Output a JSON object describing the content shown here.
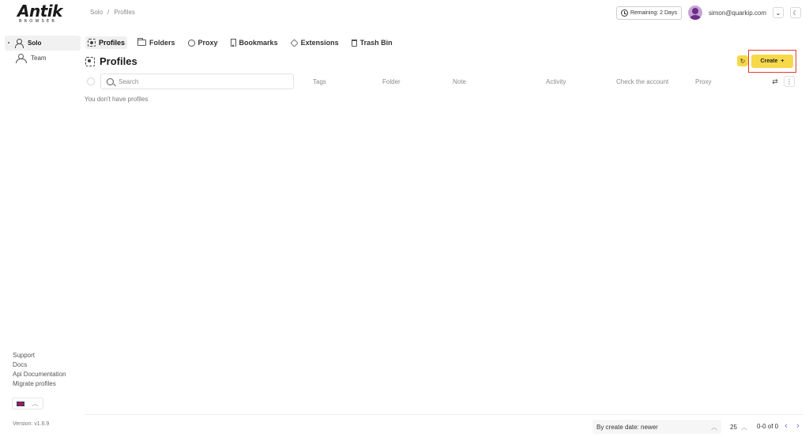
{
  "logo": {
    "main": "Antik",
    "sub": "BROWSER"
  },
  "breadcrumb": [
    "Solo",
    "/",
    "Profiles"
  ],
  "header": {
    "remaining": "Remaining: 2 Days",
    "email": "simon@quarkip.com"
  },
  "sidebar": {
    "items": [
      {
        "label": "Solo",
        "active": true
      },
      {
        "label": "Team",
        "active": false
      }
    ],
    "links": [
      "Support",
      "Docs",
      "Api Documentation",
      "Migrate profiles"
    ],
    "version": "Version: v1.6.9"
  },
  "tabs": [
    "Profiles",
    "Folders",
    "Proxy",
    "Bookmarks",
    "Extensions",
    "Trash Bin"
  ],
  "main": {
    "title": "Profiles",
    "create_label": "Create",
    "search_placeholder": "Search",
    "columns": [
      "Tags",
      "Folder",
      "Note",
      "Activity",
      "Check the account",
      "Proxy"
    ],
    "empty_message": "You don't have profiles"
  },
  "footer": {
    "sort_label": "By create date: newer",
    "per_page": "25",
    "pager_info": "0-0 of 0"
  },
  "colors": {
    "accent": "#f7d84a",
    "highlight_border": "#e53935",
    "pager": "#5a7cd6"
  },
  "icons": [
    "clock-icon",
    "avatar",
    "chevron-down-icon",
    "moon-icon",
    "person-icon",
    "team-icon",
    "profiles-icon",
    "folder-icon",
    "proxy-icon",
    "bookmark-icon",
    "extensions-icon",
    "trash-icon",
    "refresh-icon",
    "plus-icon",
    "search-icon",
    "filter-icon",
    "more-icon",
    "uk-flag-icon",
    "chevron-up-icon",
    "chevron-left-icon",
    "chevron-right-icon"
  ]
}
